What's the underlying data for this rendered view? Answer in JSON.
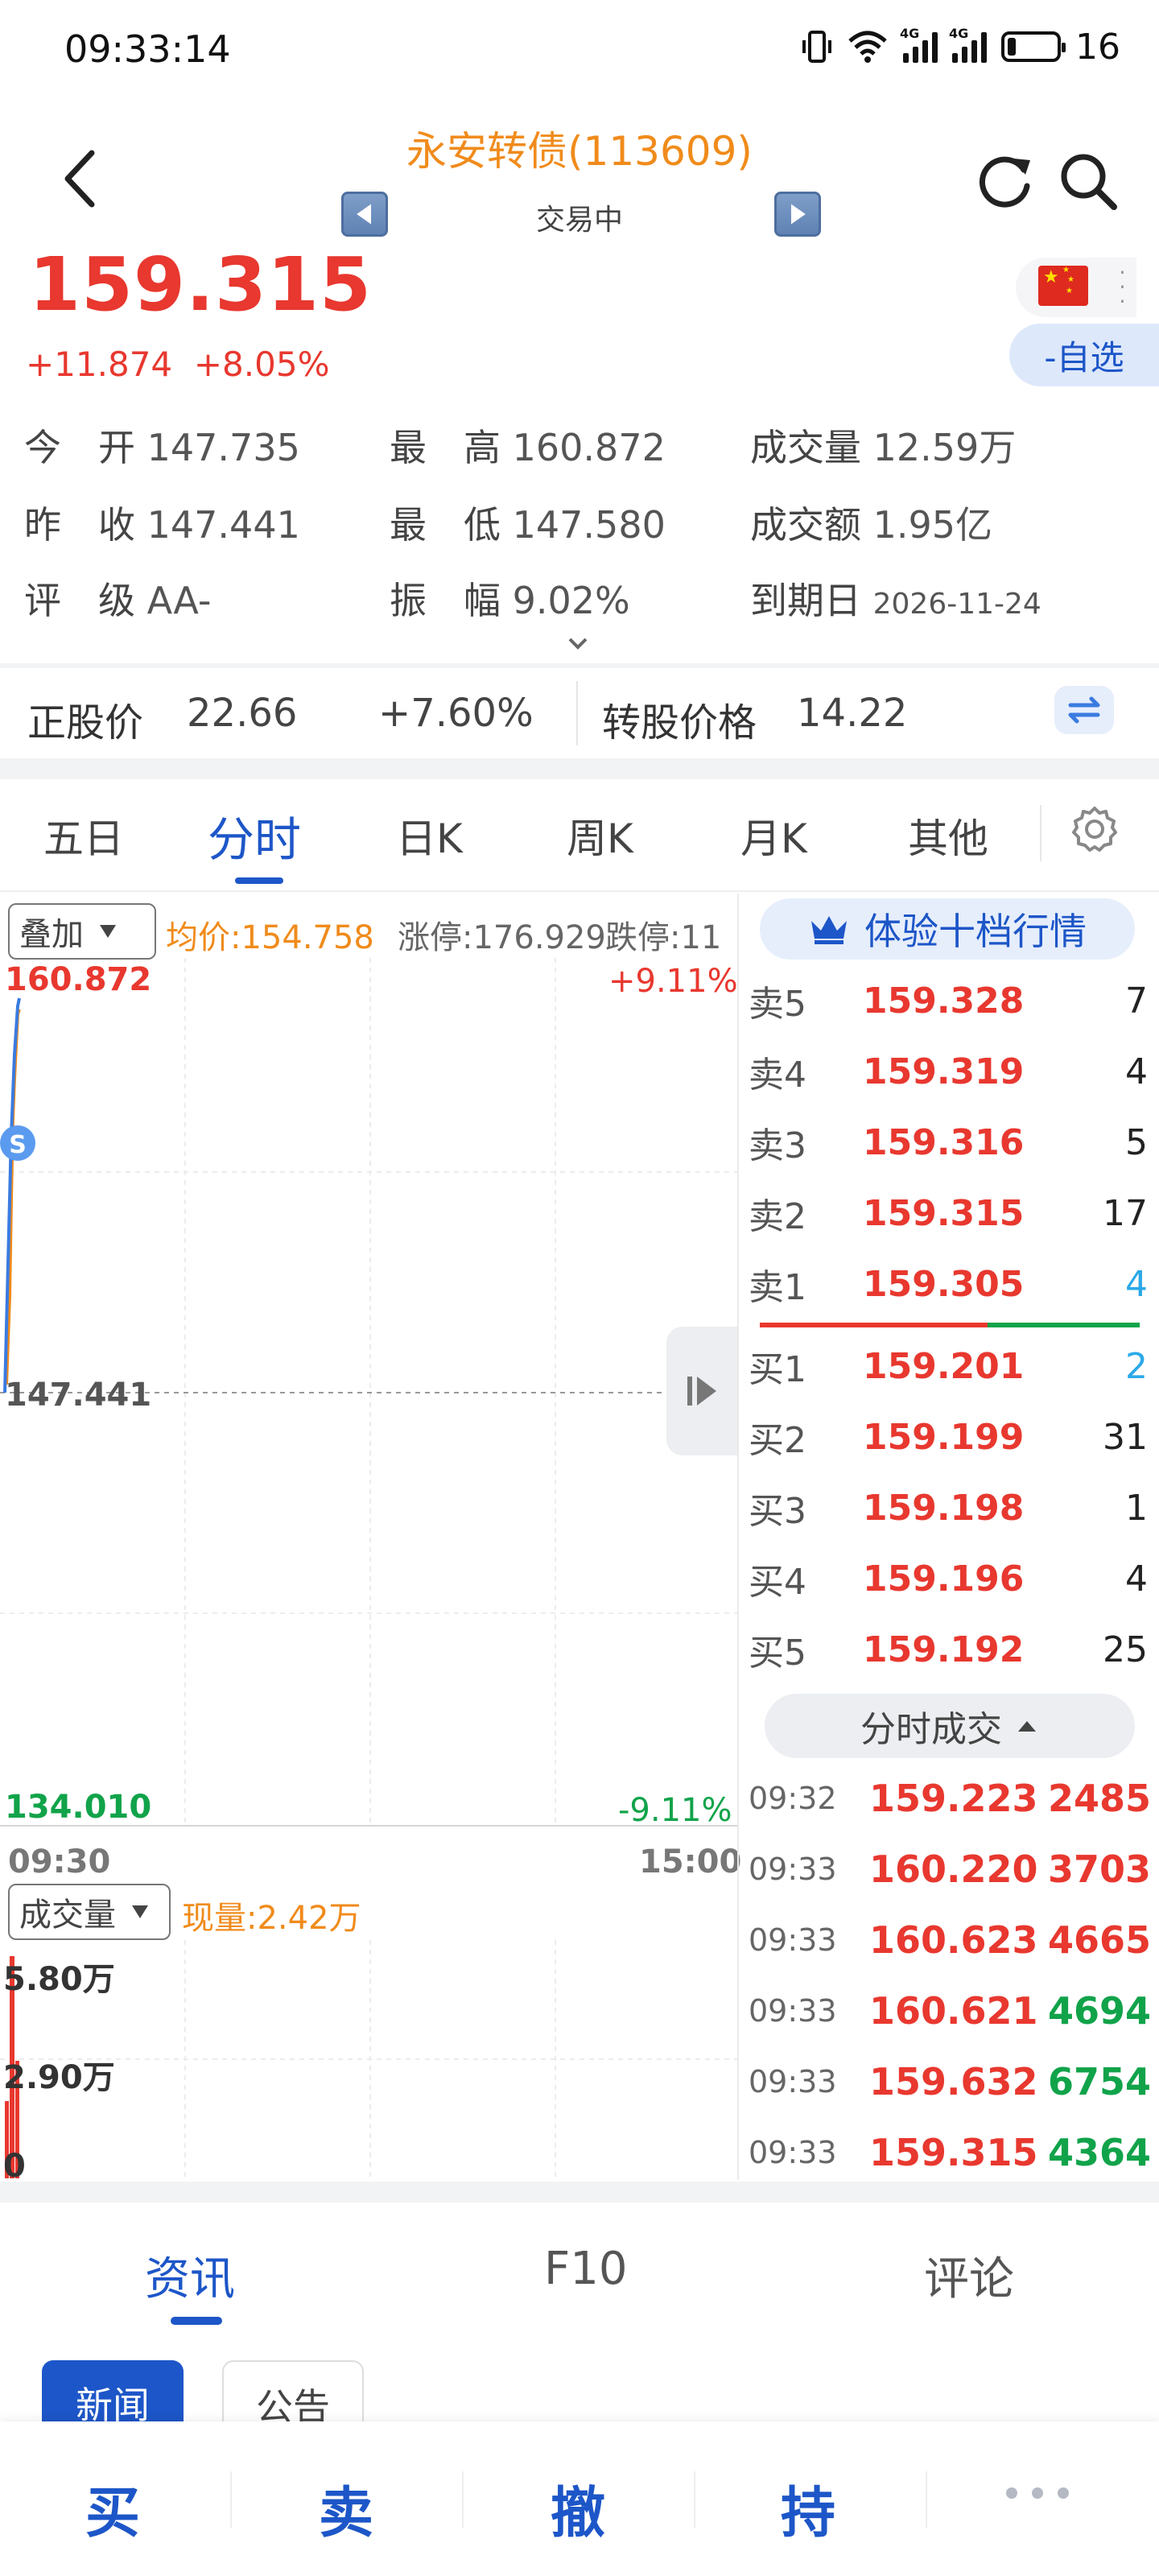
{
  "status_bar": {
    "time": "09:33:14",
    "battery": "16",
    "net_label": "4G"
  },
  "header": {
    "title": "永安转债(113609)",
    "subtitle": "交易中"
  },
  "quote": {
    "price": "159.315",
    "change": "+11.874",
    "change_pct": "+8.05%",
    "watch_label": "-自选"
  },
  "stats": [
    [
      {
        "k": "今　开",
        "v": "147.735"
      },
      {
        "k": "最　高",
        "v": "160.872"
      },
      {
        "k": "成交量",
        "v": "12.59万"
      }
    ],
    [
      {
        "k": "昨　收",
        "v": "147.441"
      },
      {
        "k": "最　低",
        "v": "147.580"
      },
      {
        "k": "成交额",
        "v": "1.95亿"
      }
    ],
    [
      {
        "k": "评　级",
        "v": "AA-"
      },
      {
        "k": "振　幅",
        "v": "9.02%"
      },
      {
        "k": "到期日",
        "v": "2026-11-24"
      }
    ]
  ],
  "stock": {
    "label": "正股价",
    "price": "22.66",
    "pct": "+7.60%",
    "conv_label": "转股价格",
    "conv_price": "14.22"
  },
  "tabs": [
    "五日",
    "分时",
    "日K",
    "周K",
    "月K",
    "其他"
  ],
  "tabs_active": "分时",
  "chart": {
    "overlay_label": "叠加",
    "avg_label": "均价:154.758",
    "limit_up": "涨停:176.929",
    "limit_down": "跌停:11",
    "y_top": "160.872",
    "y_mid": "147.441",
    "y_bottom": "134.010",
    "pct_top": "+9.11%",
    "pct_bottom": "-9.11%",
    "t_start": "09:30",
    "t_end": "15:00",
    "marker": "S",
    "volume_label": "成交量",
    "now_vol": "现量:2.42万",
    "vol_top": "5.80万",
    "vol_mid": "2.90万",
    "vol_zero": "0"
  },
  "orderbook": {
    "header": "体验十档行情",
    "asks": [
      {
        "label": "卖5",
        "price": "159.328",
        "qty": "7"
      },
      {
        "label": "卖4",
        "price": "159.319",
        "qty": "4"
      },
      {
        "label": "卖3",
        "price": "159.316",
        "qty": "5"
      },
      {
        "label": "卖2",
        "price": "159.315",
        "qty": "17"
      },
      {
        "label": "卖1",
        "price": "159.305",
        "qty": "4"
      }
    ],
    "bids": [
      {
        "label": "买1",
        "price": "159.201",
        "qty": "2"
      },
      {
        "label": "买2",
        "price": "159.199",
        "qty": "31"
      },
      {
        "label": "买3",
        "price": "159.198",
        "qty": "1"
      },
      {
        "label": "买4",
        "price": "159.196",
        "qty": "4"
      },
      {
        "label": "买5",
        "price": "159.192",
        "qty": "25"
      }
    ],
    "trades_header": "分时成交",
    "trades": [
      {
        "time": "09:32",
        "price": "159.223",
        "qty": "2485",
        "dir": "red"
      },
      {
        "time": "09:33",
        "price": "160.220",
        "qty": "3703",
        "dir": "red"
      },
      {
        "time": "09:33",
        "price": "160.623",
        "qty": "4665",
        "dir": "red"
      },
      {
        "time": "09:33",
        "price": "160.621",
        "qty": "4694",
        "dir": "green"
      },
      {
        "time": "09:33",
        "price": "159.632",
        "qty": "6754",
        "dir": "green"
      },
      {
        "time": "09:33",
        "price": "159.315",
        "qty": "4364",
        "dir": "green"
      }
    ]
  },
  "news_tabs": [
    "资讯",
    "F10",
    "评论"
  ],
  "news_pills": [
    "新闻",
    "公告"
  ],
  "bottom_bar": [
    "买",
    "卖",
    "撤",
    "持"
  ],
  "colors": {
    "up": "#e8382f",
    "down": "#11a34a",
    "accent": "#1d56c8",
    "title": "#f08b1b"
  }
}
